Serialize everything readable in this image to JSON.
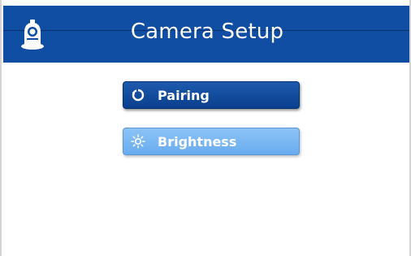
{
  "header": {
    "title": "Camera Setup",
    "color": "#0f4ea3"
  },
  "home_button": {
    "icon": "camera-icon"
  },
  "menu": {
    "items": [
      {
        "label": "Pairing",
        "icon": "refresh-icon",
        "style": "dark"
      },
      {
        "label": "Brightness",
        "icon": "sun-icon",
        "style": "light"
      }
    ]
  }
}
